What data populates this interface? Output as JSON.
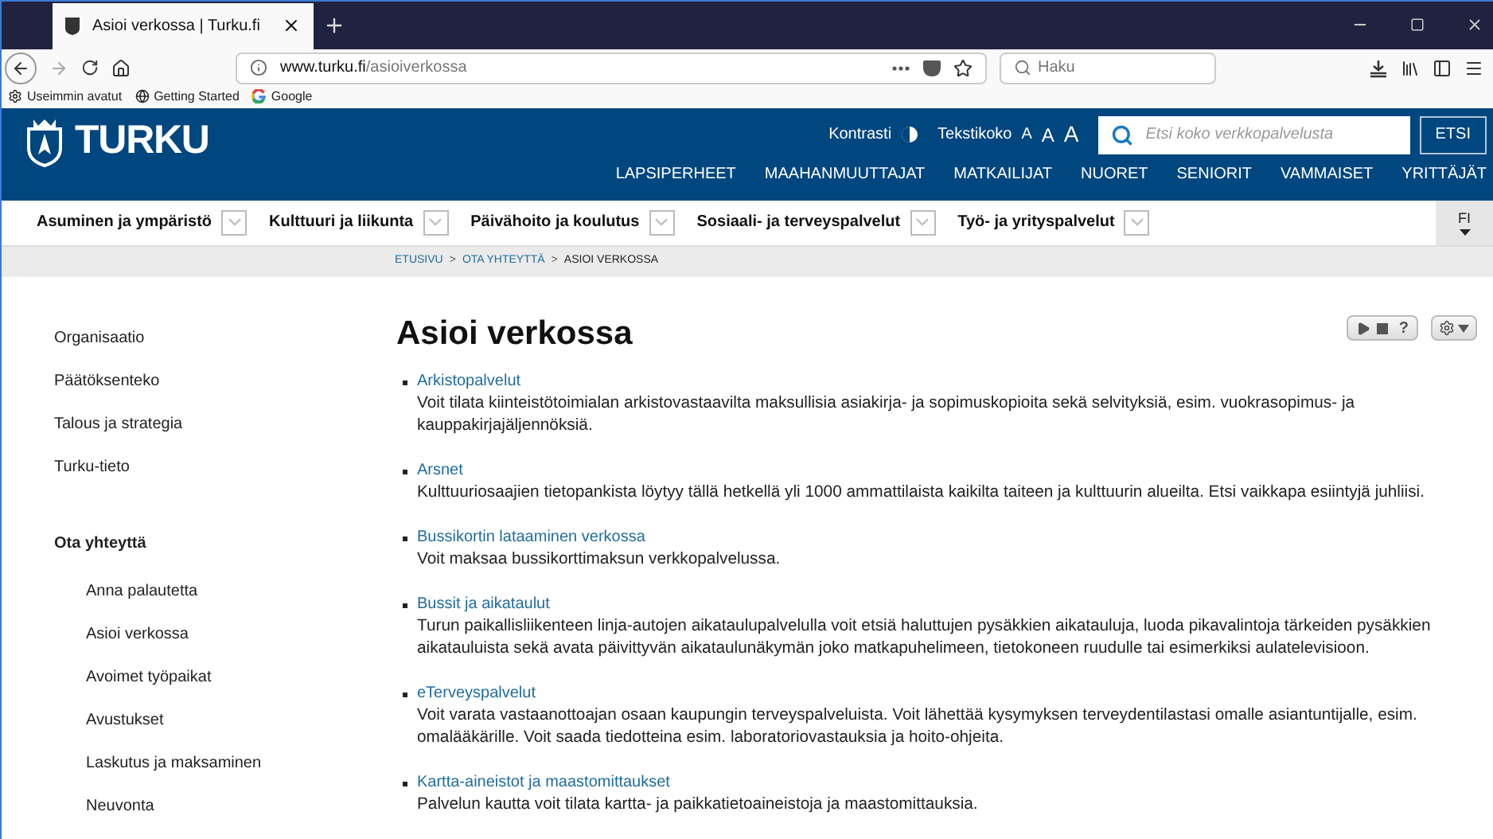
{
  "browser": {
    "tab_title": "Asioi verkossa | Turku.fi",
    "url_domain": "www.turku.fi",
    "url_path": "/asioiverkossa",
    "search_placeholder": "Haku",
    "bookmarks": [
      "Useimmin avatut",
      "Getting Started",
      "Google"
    ]
  },
  "header": {
    "logo": "TURKU",
    "contrast": "Kontrasti",
    "text_size": "Tekstikoko",
    "size_letters": [
      "A",
      "A",
      "A"
    ],
    "search_placeholder": "Etsi koko verkkopalvelusta",
    "search_button": "ETSI",
    "nav": [
      "LAPSIPERHEET",
      "MAAHANMUUTTAJAT",
      "MATKAILIJAT",
      "NUORET",
      "SENIORIT",
      "VAMMAISET",
      "YRITTÄJÄT"
    ]
  },
  "categories": [
    "Asuminen ja ympäristö",
    "Kulttuuri ja liikunta",
    "Päivähoito ja koulutus",
    "Sosiaali- ja terveyspalvelut",
    "Työ- ja yrityspalvelut"
  ],
  "language": "FI",
  "breadcrumb": {
    "separator": ">",
    "items": [
      "ETUSIVU",
      "OTA YHTEYTTÄ",
      "ASIOI VERKOSSA"
    ]
  },
  "sidebar": [
    {
      "label": "Organisaatio",
      "selected": false
    },
    {
      "label": "Päätöksenteko",
      "selected": false
    },
    {
      "label": "Talous ja strategia",
      "selected": false
    },
    {
      "label": "Turku-tieto",
      "selected": false
    },
    {
      "label": "Ota yhteyttä",
      "selected": true,
      "children": [
        {
          "label": "Anna palautetta",
          "selected": false
        },
        {
          "label": "Asioi verkossa",
          "selected": false
        },
        {
          "label": "Avoimet työpaikat",
          "selected": false
        },
        {
          "label": "Avustukset",
          "selected": false
        },
        {
          "label": "Laskutus ja maksaminen",
          "selected": false
        },
        {
          "label": "Neuvonta",
          "selected": false
        }
      ]
    }
  ],
  "page_title": "Asioi verkossa",
  "help_label": "?",
  "services": [
    {
      "title": "Arkistopalvelut",
      "description": "Voit tilata kiinteistötoimialan arkistovastaavilta maksullisia asiakirja- ja sopimuskopioita sekä selvityksiä, esim. vuokrasopimus- ja kauppakirjajäljennöksiä."
    },
    {
      "title": "Arsnet",
      "description": "Kulttuuriosaajien tietopankista löytyy tällä hetkellä yli 1000 ammattilaista kaikilta taiteen ja kulttuurin alueilta. Etsi vaikkapa esiintyjä juhliisi."
    },
    {
      "title": "Bussikortin lataaminen verkossa",
      "description": "Voit maksaa bussikorttimaksun verkkopalvelussa."
    },
    {
      "title": "Bussit ja aikataulut",
      "description": "Turun paikallisliikenteen linja-autojen aikataulupalvelulla voit etsiä haluttujen pysäkkien aikatauluja, luoda pikavalintoja tärkeiden pysäkkien aikatauluista sekä avata päivittyvän aikataulunäkymän joko matkapuhelimeen, tietokoneen ruudulle tai esimerkiksi aulatelevisioon."
    },
    {
      "title": "eTerveyspalvelut",
      "description": "Voit varata vastaanottoajan osaan kaupungin terveyspalveluista. Voit lähettää kysymyksen terveydentilastasi omalle asiantuntijalle, esim. omalääkärille. Voit saada tiedotteina esim. laboratoriovastauksia ja hoito-ohjeita."
    },
    {
      "title": "Kartta-aineistot ja maastomittaukset",
      "description": "Palvelun kautta voit tilata kartta- ja paikkatietoaineistoja ja maastomittauksia."
    }
  ]
}
